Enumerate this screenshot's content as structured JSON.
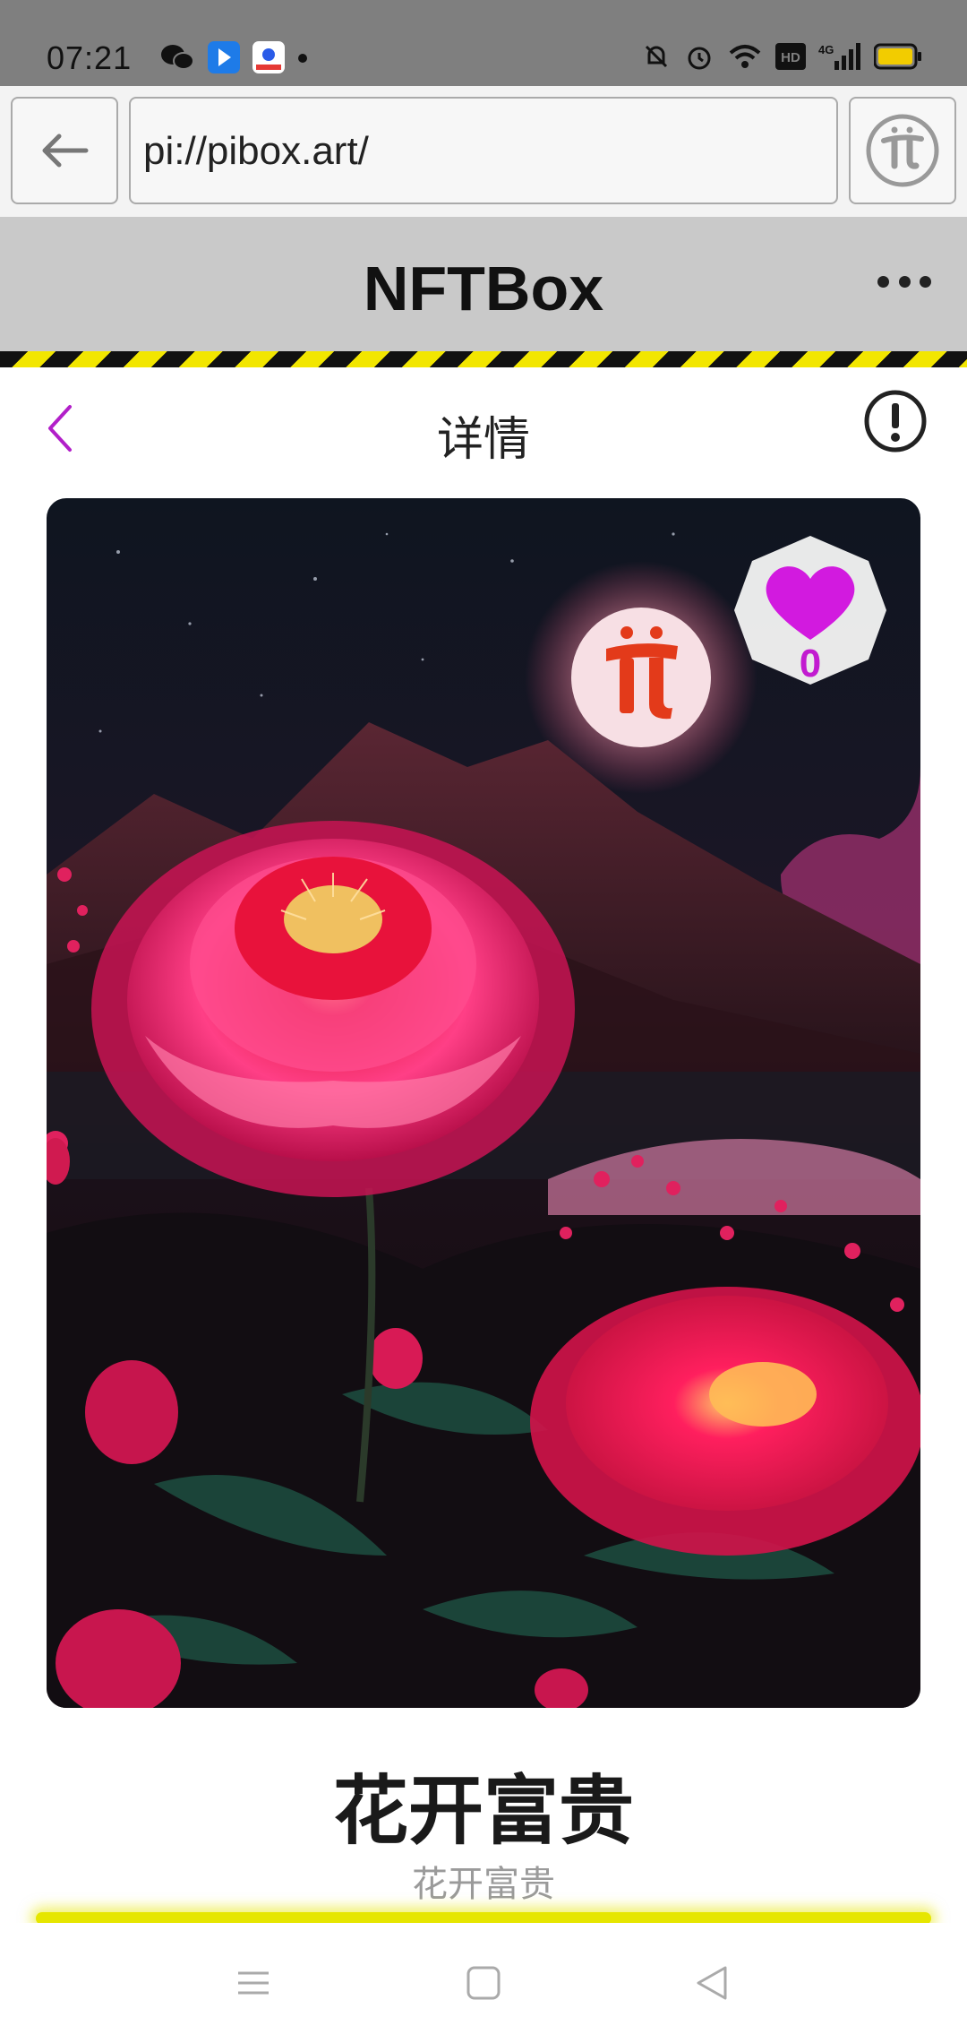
{
  "status_bar": {
    "time": "07:21",
    "left_icons": [
      "wechat-icon",
      "blue-app-icon",
      "baidu-icon",
      "notification-dot-icon"
    ],
    "right_icons": [
      "mute-icon",
      "alarm-icon",
      "wifi-icon",
      "hd-icon",
      "signal-4g-icon",
      "battery-icon"
    ],
    "hd_label": "HD",
    "network_label": "4G"
  },
  "browser": {
    "url": "pi://pibox.art/"
  },
  "app": {
    "title": "NFTBox"
  },
  "detail": {
    "title": "详情"
  },
  "nft": {
    "like_count": "0",
    "name": "花开富贵",
    "subtitle": "花开富贵"
  },
  "colors": {
    "accent_purple": "#c21bd0",
    "header_gray": "#c9c9c9",
    "hazard_yellow": "#f2e600"
  }
}
